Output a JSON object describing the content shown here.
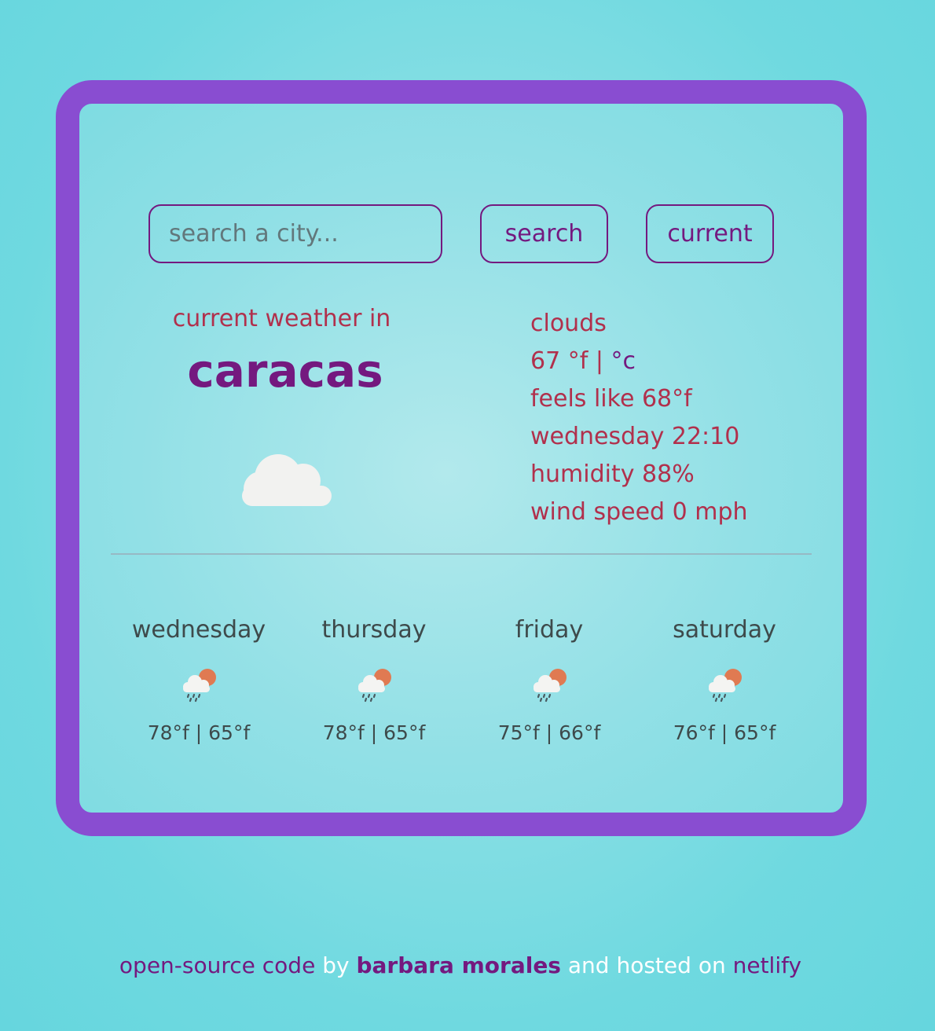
{
  "search": {
    "placeholder": "search a city...",
    "search_label": "search",
    "current_label": "current"
  },
  "current": {
    "heading": "current weather in",
    "city": "caracas",
    "icon": "cloud-icon",
    "description": "clouds",
    "temperature": "67",
    "unit_f": "°f",
    "separator": "|",
    "unit_c": "°c",
    "feels_like": "feels like 68°f",
    "datetime": "wednesday 22:10",
    "humidity": "humidity 88%",
    "wind": "wind speed 0 mph"
  },
  "forecast": [
    {
      "day": "wednesday",
      "icon": "rain-sun-icon",
      "temps": "78°f | 65°f"
    },
    {
      "day": "thursday",
      "icon": "rain-sun-icon",
      "temps": "78°f | 65°f"
    },
    {
      "day": "friday",
      "icon": "rain-sun-icon",
      "temps": "75°f | 66°f"
    },
    {
      "day": "saturday",
      "icon": "rain-sun-icon",
      "temps": "76°f | 65°f"
    }
  ],
  "footer": {
    "source_link": "open-source code",
    "by": "by",
    "author": "barbara morales",
    "hosted": "and hosted on",
    "host_link": "netlify"
  },
  "colors": {
    "frame": "#894dd1",
    "accent": "#74197f",
    "text_red": "#b1304c",
    "background": "#6fd9e0"
  }
}
